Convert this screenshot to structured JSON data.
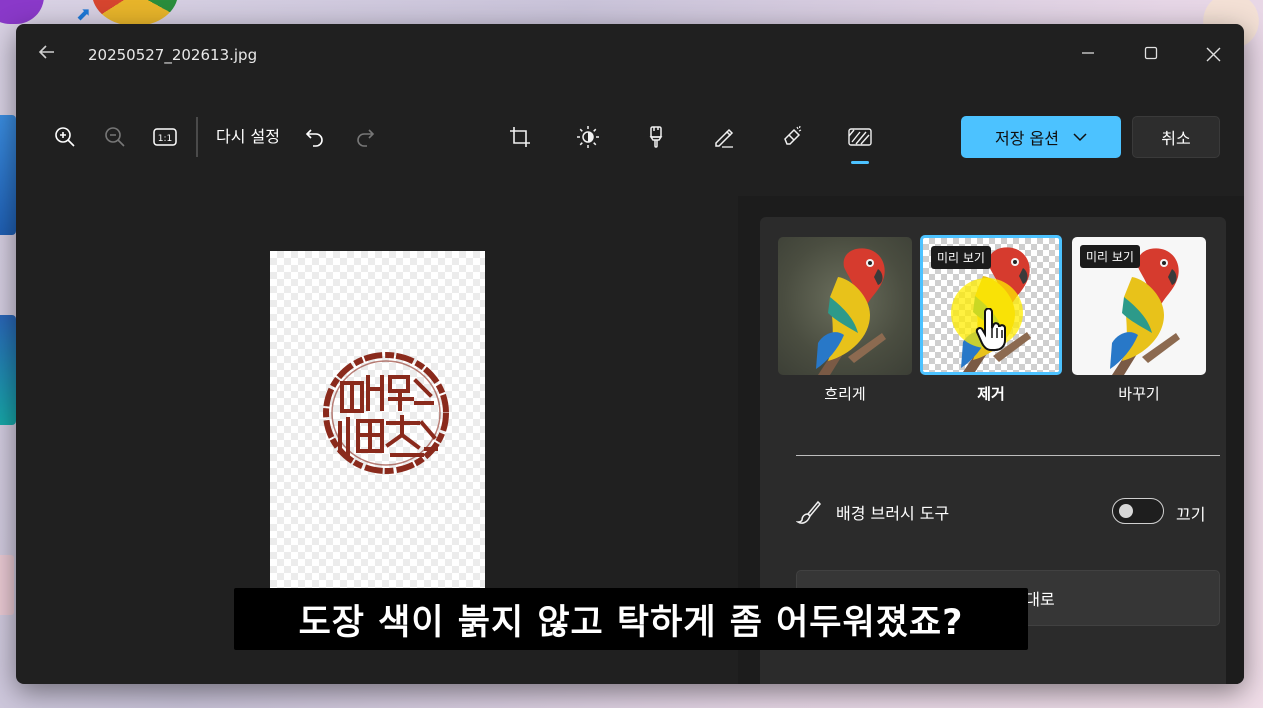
{
  "window": {
    "file_name": "20250527_202613.jpg"
  },
  "toolbar": {
    "reset_label": "다시 설정",
    "zoom_reset_label": "1:1",
    "save_label": "저장 옵션",
    "cancel_label": "취소",
    "active_tool": "background-removal"
  },
  "background_panel": {
    "options": [
      {
        "label": "흐리게",
        "badge": ""
      },
      {
        "label": "제거",
        "badge": "미리 보기",
        "selected": true
      },
      {
        "label": "바꾸기",
        "badge": "미리 보기"
      }
    ],
    "brush_tool_label": "배경 브러시 도구",
    "brush_toggle_state": "끄기",
    "restore_label": "배경 원래대로"
  },
  "subtitle": "도장 색이 붉지 않고 탁하게 좀 어두워졌죠?",
  "colors": {
    "accent": "#4cc2ff",
    "window_bg": "#202020",
    "panel_bg": "#2b2b2b",
    "seal_red": "#8a2a1c"
  }
}
